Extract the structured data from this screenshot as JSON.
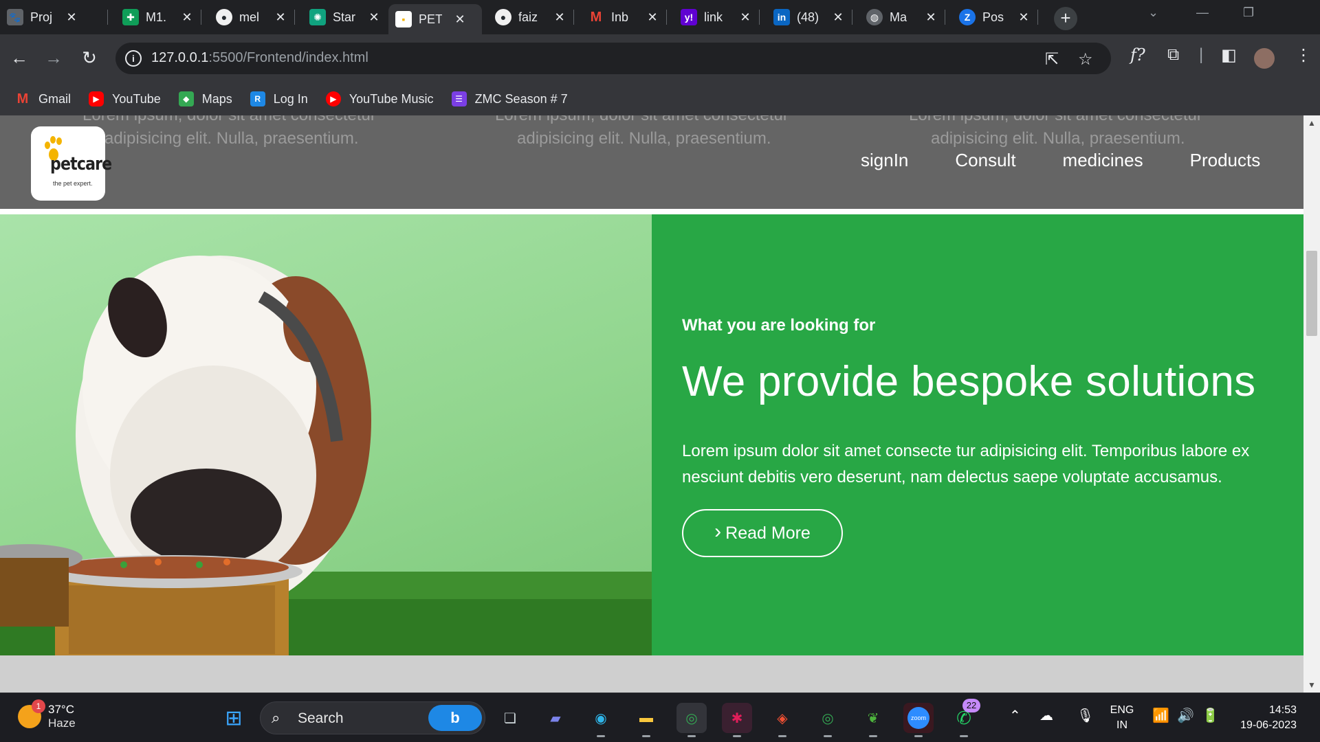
{
  "tabs": [
    {
      "title": "Proj",
      "icon": "paw-favicon",
      "color": "#5f6368"
    },
    {
      "title": "M1.",
      "icon": "sheets-favicon",
      "color": "#0f9d58"
    },
    {
      "title": "mel",
      "icon": "github-favicon",
      "color": "#24292e"
    },
    {
      "title": "Star",
      "icon": "chatgpt-favicon",
      "color": "#10a37f"
    },
    {
      "title": "PET",
      "icon": "pet-favicon",
      "color": "#ffffff",
      "active": true
    },
    {
      "title": "faiz",
      "icon": "github-favicon",
      "color": "#24292e"
    },
    {
      "title": "Inb",
      "icon": "gmail-favicon",
      "color": "#ea4335"
    },
    {
      "title": "link",
      "icon": "yahoo-favicon",
      "color": "#6001d2"
    },
    {
      "title": "(48)",
      "icon": "linkedin-favicon",
      "color": "#0a66c2"
    },
    {
      "title": "Ma",
      "icon": "globe-favicon",
      "color": "#5f6368"
    },
    {
      "title": "Pos",
      "icon": "zoho-favicon",
      "color": "#1a73e8"
    }
  ],
  "address": {
    "host": "127.0.0.1",
    "rest": ":5500/Frontend/index.html"
  },
  "bookmarks": [
    {
      "label": "Gmail",
      "icon": "gmail-icon",
      "color": "#ea4335"
    },
    {
      "label": "YouTube",
      "icon": "youtube-icon",
      "color": "#ff0000"
    },
    {
      "label": "Maps",
      "icon": "maps-icon",
      "color": "#34a853"
    },
    {
      "label": "Log In",
      "icon": "login-icon",
      "color": "#1e88e5"
    },
    {
      "label": "YouTube Music",
      "icon": "youtube-music-icon",
      "color": "#ff0000"
    },
    {
      "label": "ZMC Season # 7",
      "icon": "list-icon",
      "color": "#7b3fe4"
    }
  ],
  "site": {
    "bg_text": {
      "line1": "Lorem ipsum, dolor sit amet consectetur",
      "line2": "adipisicing elit. Nulla, praesentium."
    },
    "logo": {
      "name": "petcare",
      "tagline": "the pet expert."
    },
    "nav": [
      "signIn",
      "Consult",
      "medicines",
      "Products"
    ],
    "hero": {
      "kicker": "What you are looking for",
      "headline": "We provide bespoke solutions",
      "lead": "Lorem ipsum dolor sit amet consecte tur adipisicing elit. Temporibus labore ex nesciunt debitis vero deserunt, nam delectus saepe voluptate accusamus.",
      "cta": "Read More",
      "panel_color": "#28a745"
    }
  },
  "taskbar": {
    "weather": {
      "temp": "37°C",
      "desc": "Haze",
      "badge": "1"
    },
    "search": "Search",
    "whatsapp_badge": "22",
    "lang": {
      "line1": "ENG",
      "line2": "IN"
    },
    "time": "14:53",
    "date": "19-06-2023"
  }
}
